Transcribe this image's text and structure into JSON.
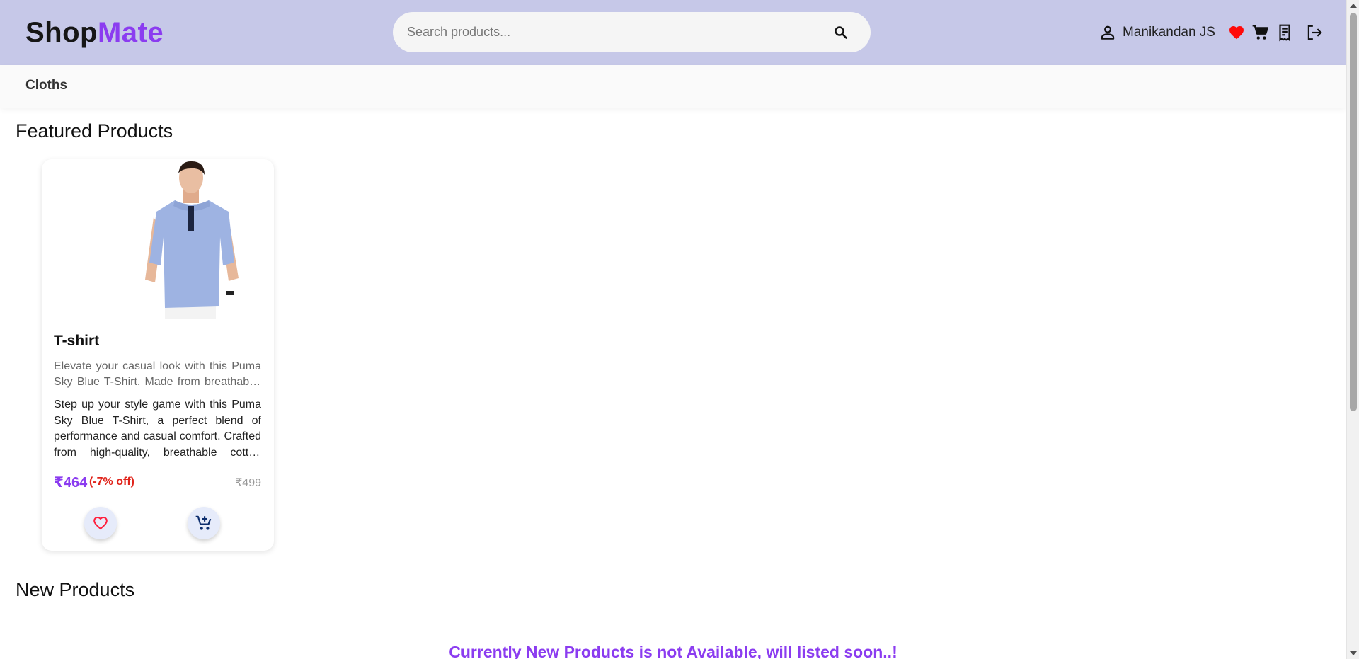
{
  "header": {
    "logo_part1": "Shop",
    "logo_part2": "Mate",
    "search_placeholder": "Search products...",
    "user_name": "Manikandan JS",
    "icons": [
      "person-icon",
      "heart-icon",
      "cart-icon",
      "orders-icon",
      "logout-icon"
    ]
  },
  "nav": {
    "categories": [
      "Cloths"
    ]
  },
  "featured": {
    "title": "Featured Products",
    "products": [
      {
        "name": "T-shirt",
        "short_description": "Elevate your casual look with this Puma Sky Blue T-Shirt. Made from breathable, lightweight cotton for all-day comfort.",
        "long_description": "Step up your style game with this Puma Sky Blue T-Shirt, a perfect blend of performance and casual comfort. Crafted from high-quality, breathable cotton fabric for everyday wear.",
        "price": "₹464",
        "discount": "(-7% off)",
        "mrp": "₹499"
      }
    ]
  },
  "new_products": {
    "title": "New Products",
    "empty_message": "Currently New Products is not Available, will listed soon..!"
  },
  "colors": {
    "header_bg": "#c6c8e8",
    "accent": "#8b3cf0",
    "discount": "#e0241b",
    "heart": "#ff0000"
  }
}
